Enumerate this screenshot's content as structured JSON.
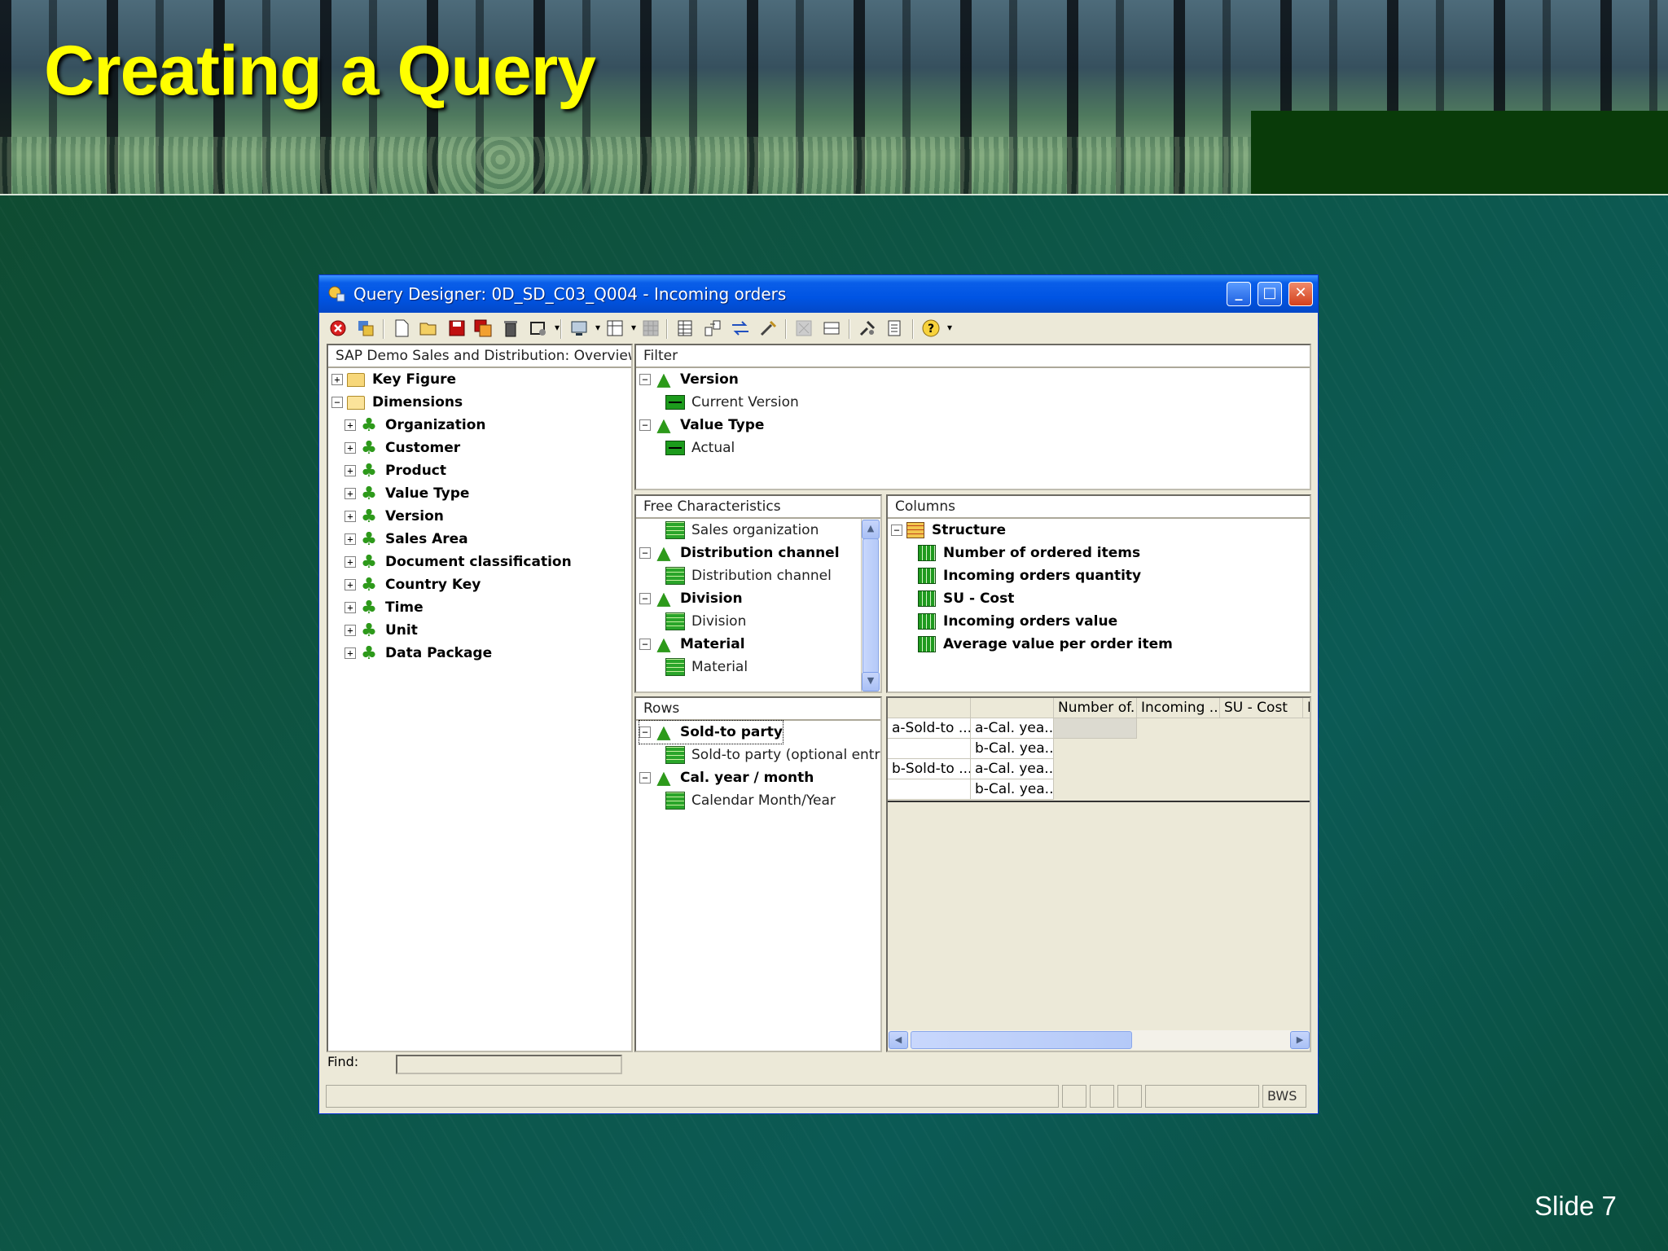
{
  "slide": {
    "title": "Creating a Query",
    "number_label": "Slide 7"
  },
  "window": {
    "title": "Query Designer: 0D_SD_C03_Q004 - Incoming orders",
    "controls": {
      "minimize": "_",
      "maximize": "□",
      "close": "✕"
    }
  },
  "toolbar": {
    "icons": [
      "exit-icon",
      "check-icon",
      "new-icon",
      "open-icon",
      "save-icon",
      "save-as-icon",
      "delete-icon",
      "query-properties-icon",
      "display-icon",
      "layout-icon",
      "grid-icon",
      "table-icon",
      "move-icon",
      "swap-icon",
      "tools-icon",
      "disabled-icon",
      "cells-icon",
      "exceptions-icon",
      "technical-names-icon",
      "help-icon"
    ]
  },
  "infoprovider": {
    "header": "SAP Demo Sales and Distribution: Overview",
    "key_figure": "Key Figure",
    "dimensions": "Dimensions",
    "dimension_items": [
      "Organization",
      "Customer",
      "Product",
      "Value Type",
      "Version",
      "Sales Area",
      "Document classification",
      "Country Key",
      "Time",
      "Unit",
      "Data Package"
    ],
    "find_label": "Find:",
    "find_value": ""
  },
  "filter": {
    "header": "Filter",
    "items": [
      {
        "name": "Version",
        "value": "Current Version"
      },
      {
        "name": "Value Type",
        "value": "Actual"
      }
    ]
  },
  "free_characteristics": {
    "header": "Free Characteristics",
    "items": [
      {
        "label": "Sales organization",
        "level": "child"
      },
      {
        "label": "Distribution channel",
        "level": "parent"
      },
      {
        "label": "Distribution channel",
        "level": "child"
      },
      {
        "label": "Division",
        "level": "parent"
      },
      {
        "label": "Division",
        "level": "child"
      },
      {
        "label": "Material",
        "level": "parent"
      },
      {
        "label": "Material",
        "level": "child"
      }
    ]
  },
  "columns": {
    "header": "Columns",
    "structure": "Structure",
    "items": [
      "Number of ordered items",
      "Incoming orders quantity",
      "SU - Cost",
      "Incoming orders value",
      "Average value per order item"
    ]
  },
  "rows": {
    "header": "Rows",
    "items": [
      {
        "label": "Sold-to party",
        "level": "parent"
      },
      {
        "label": "Sold-to party (optional entry)",
        "level": "child"
      },
      {
        "label": "Cal. year / month",
        "level": "parent"
      },
      {
        "label": "Calendar Month/Year",
        "level": "child"
      }
    ]
  },
  "preview": {
    "col_headers": [
      "",
      "",
      "Number of...",
      "Incoming ...",
      "SU - Cost",
      "I"
    ],
    "rows": [
      [
        "a-Sold-to ...",
        "a-Cal. yea..."
      ],
      [
        "",
        "b-Cal. yea..."
      ],
      [
        "b-Sold-to ...",
        "a-Cal. yea..."
      ],
      [
        "",
        "b-Cal. yea..."
      ]
    ]
  },
  "status": {
    "system": "BWS"
  }
}
